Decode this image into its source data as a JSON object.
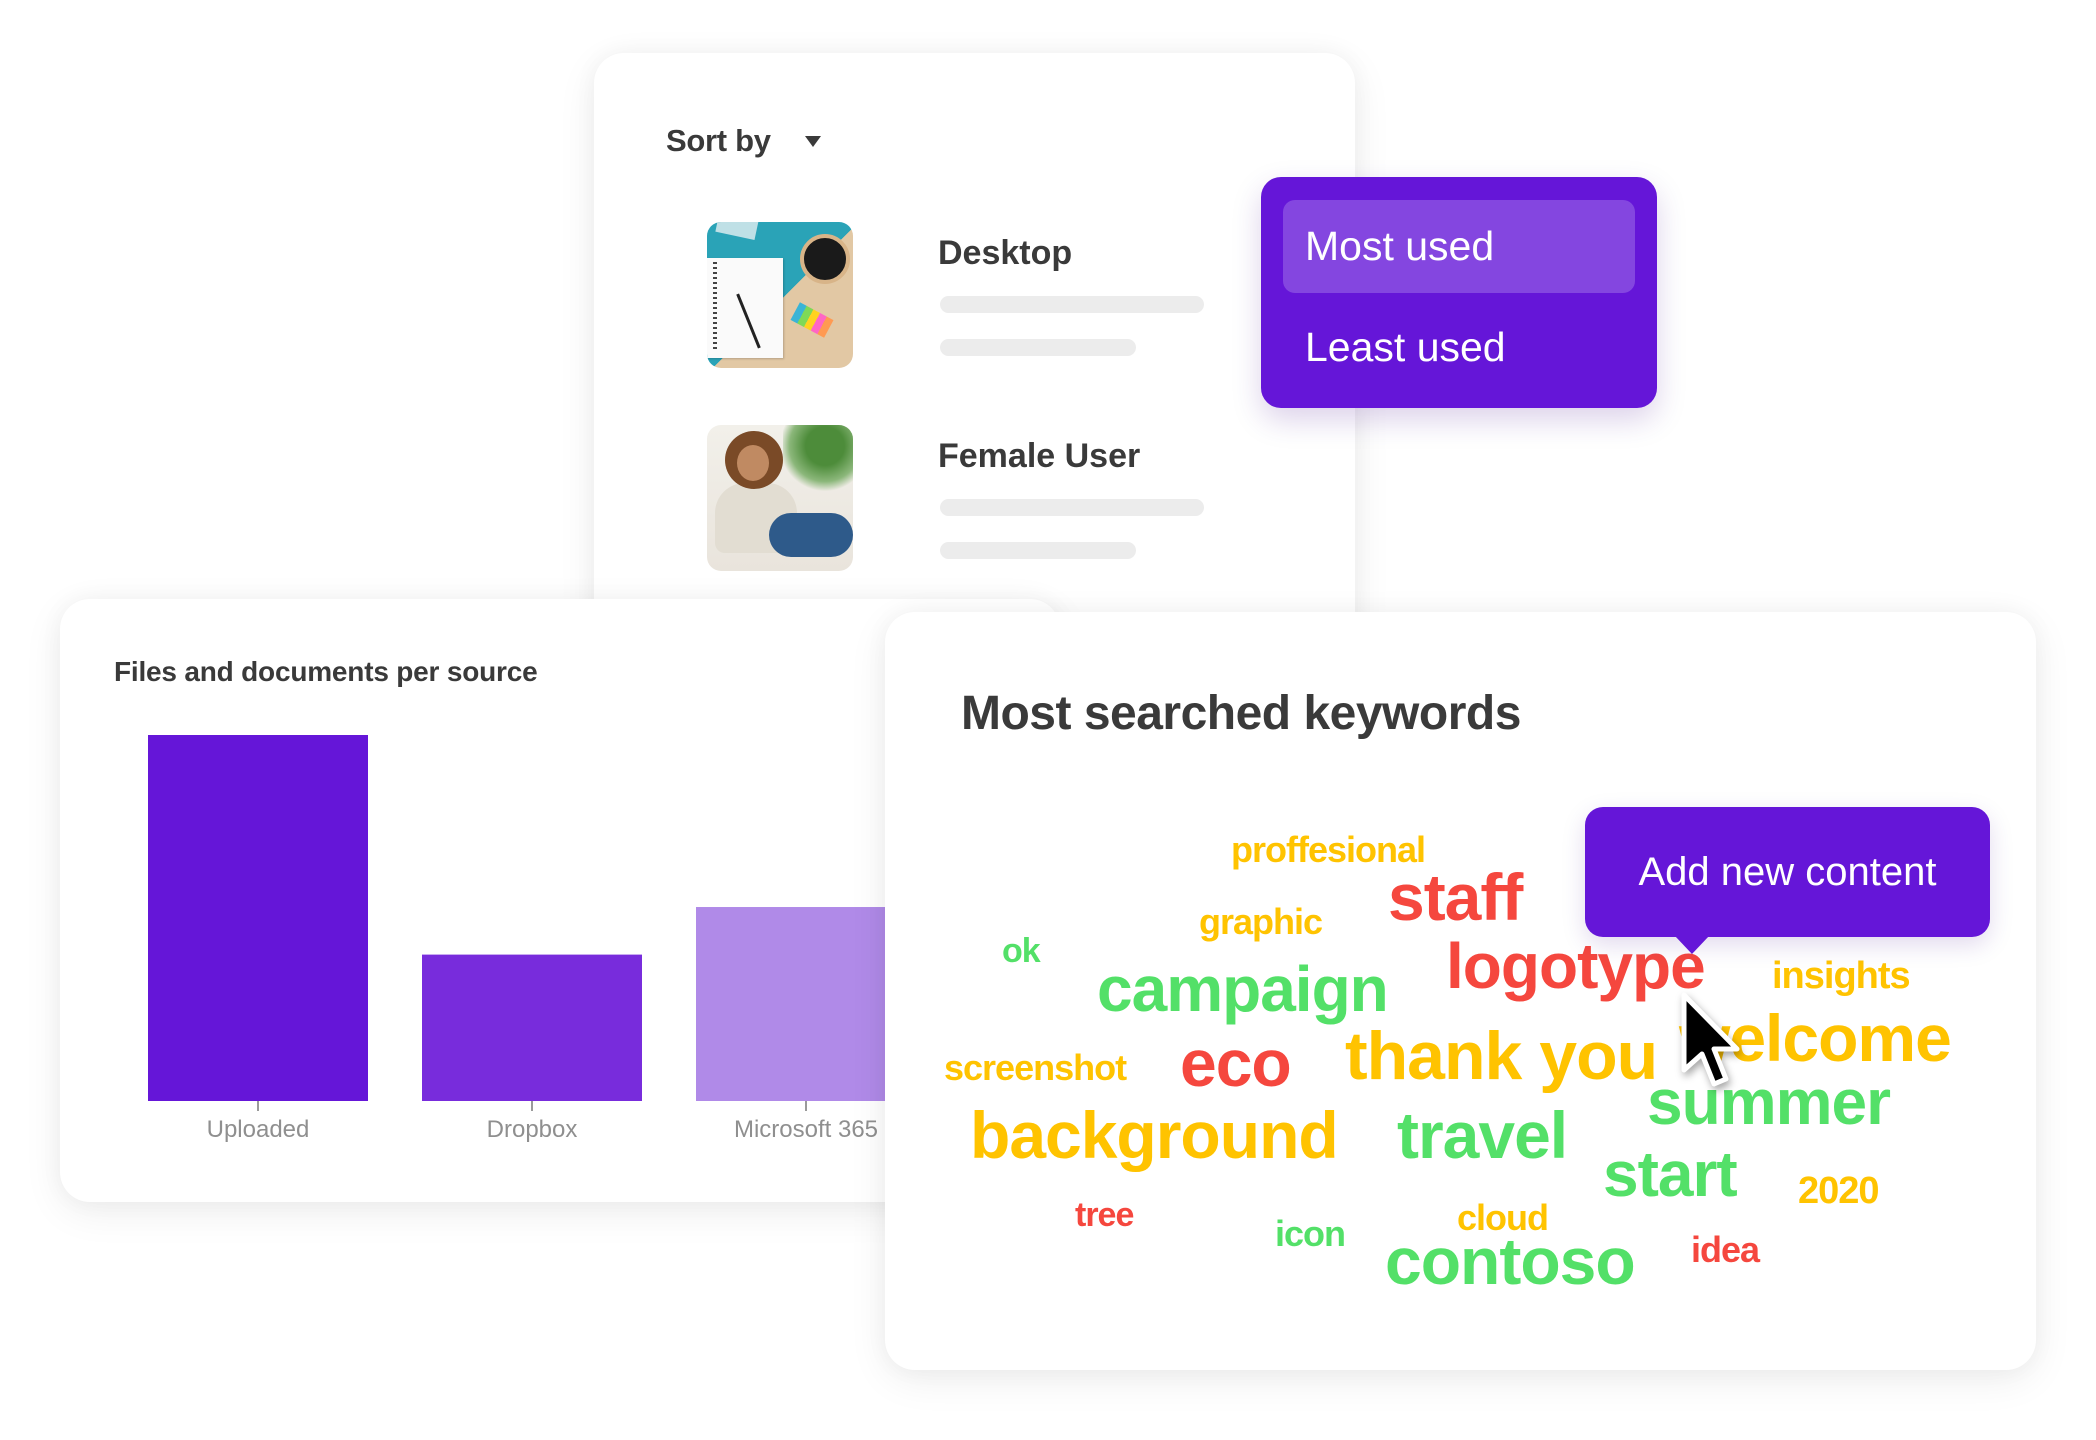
{
  "sort_panel": {
    "sort_label": "Sort by",
    "caret_icon": "caret-down-icon",
    "items": [
      {
        "title": "Desktop",
        "thumbnail": "desk-flatlay-photo"
      },
      {
        "title": "Female User",
        "thumbnail": "woman-with-phone-photo"
      },
      {
        "title": "",
        "thumbnail": "mountain-landscape-photo"
      }
    ]
  },
  "sort_dropdown": {
    "options": [
      {
        "label": "Most used",
        "selected": true
      },
      {
        "label": "Least used",
        "selected": false
      }
    ],
    "colors": {
      "background": "#6516d8",
      "selected": "#8446e0"
    }
  },
  "chart_data": {
    "type": "bar",
    "title": "Files and documents per source",
    "categories": [
      "Uploaded",
      "Dropbox",
      "Microsoft 365"
    ],
    "values": [
      100,
      40,
      53
    ],
    "colors": [
      "#6516d8",
      "#782cdc",
      "#b08ae8"
    ],
    "xlabel": "",
    "ylabel": "",
    "ylim": [
      0,
      100
    ],
    "grid": false,
    "legend": "none"
  },
  "keywords_panel": {
    "title": "Most searched keywords",
    "colors": {
      "red": "#f5473e",
      "yellow": "#ffc300",
      "green": "#53e068"
    },
    "words": [
      {
        "text": "proffesional",
        "color": "yellow",
        "weight": "small"
      },
      {
        "text": "staff",
        "color": "red",
        "weight": "large"
      },
      {
        "text": "graphic",
        "color": "yellow",
        "weight": "small"
      },
      {
        "text": "ok",
        "color": "green",
        "weight": "small"
      },
      {
        "text": "logotype",
        "color": "red",
        "weight": "large"
      },
      {
        "text": "insights",
        "color": "yellow",
        "weight": "small"
      },
      {
        "text": "campaign",
        "color": "green",
        "weight": "large"
      },
      {
        "text": "screenshot",
        "color": "yellow",
        "weight": "small"
      },
      {
        "text": "eco",
        "color": "red",
        "weight": "large"
      },
      {
        "text": "thank you",
        "color": "yellow",
        "weight": "large"
      },
      {
        "text": "welcome",
        "color": "yellow",
        "weight": "large"
      },
      {
        "text": "summer",
        "color": "green",
        "weight": "large"
      },
      {
        "text": "background",
        "color": "yellow",
        "weight": "large"
      },
      {
        "text": "travel",
        "color": "green",
        "weight": "large"
      },
      {
        "text": "start",
        "color": "green",
        "weight": "large"
      },
      {
        "text": "2020",
        "color": "yellow",
        "weight": "small"
      },
      {
        "text": "tree",
        "color": "red",
        "weight": "small"
      },
      {
        "text": "cloud",
        "color": "yellow",
        "weight": "small"
      },
      {
        "text": "icon",
        "color": "green",
        "weight": "small"
      },
      {
        "text": "contoso",
        "color": "green",
        "weight": "large"
      },
      {
        "text": "idea",
        "color": "red",
        "weight": "small"
      }
    ]
  },
  "tooltip": {
    "label": "Add new content"
  },
  "cursor": {
    "icon": "arrow-pointer-icon"
  }
}
